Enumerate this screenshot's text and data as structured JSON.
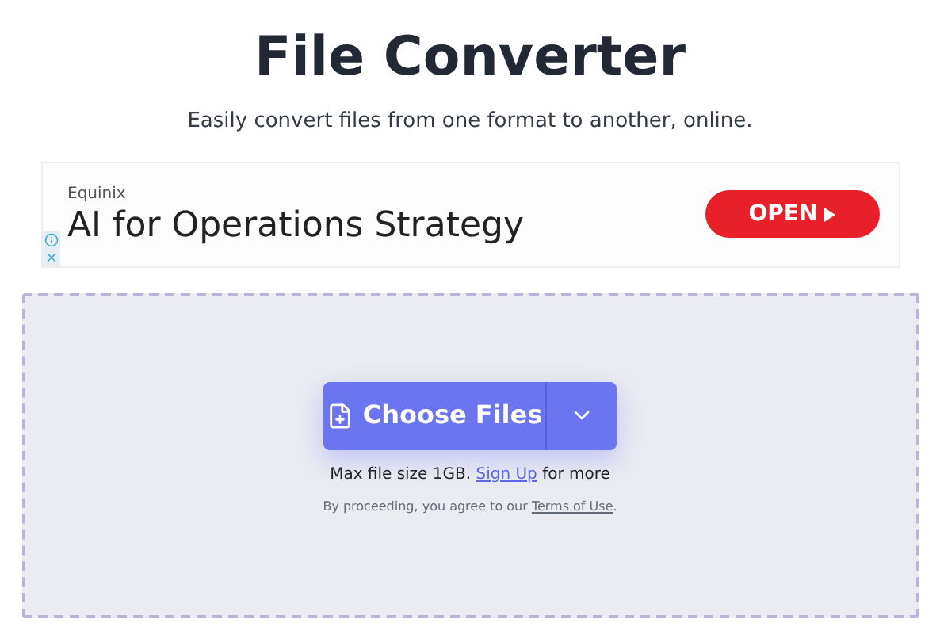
{
  "header": {
    "title": "File Converter",
    "subtitle": "Easily convert files from one format to another, online."
  },
  "ad": {
    "advertiser": "Equinix",
    "headline": "AI for Operations Strategy",
    "button": "OPEN"
  },
  "upload": {
    "button": "Choose Files",
    "limit": {
      "before": "Max file size 1GB.",
      "link": "Sign Up",
      "after": "for more"
    },
    "terms": {
      "before": "By proceeding, you agree to our",
      "link": "Terms of Use",
      "after": "."
    }
  }
}
